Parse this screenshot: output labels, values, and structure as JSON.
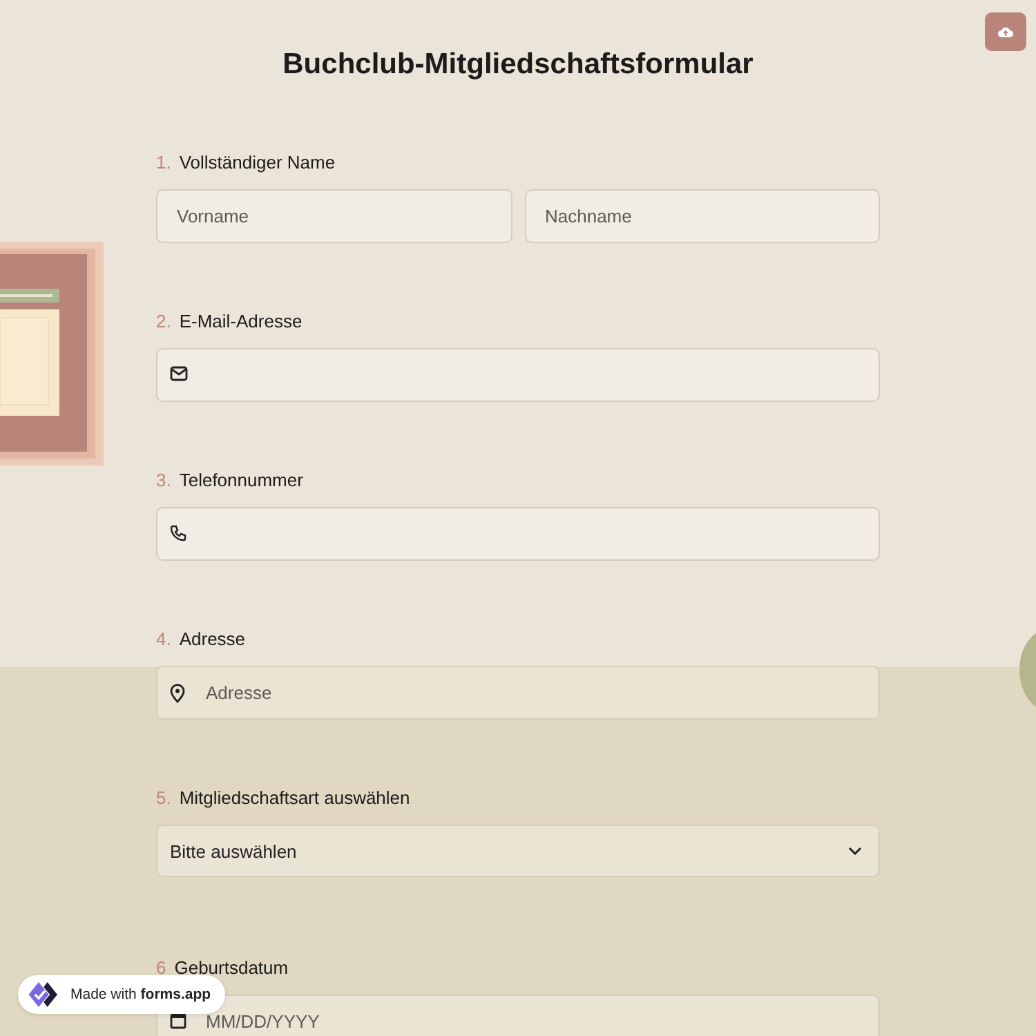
{
  "title": "Buchclub-Mitgliedschaftsformular",
  "questions": [
    {
      "number": "1.",
      "label": "Vollständiger Name",
      "kind": "name",
      "fields": [
        {
          "placeholder": "Vorname"
        },
        {
          "placeholder": "Nachname"
        }
      ]
    },
    {
      "number": "2.",
      "label": "E-Mail-Adresse",
      "kind": "email"
    },
    {
      "number": "3.",
      "label": "Telefonnummer",
      "kind": "phone"
    },
    {
      "number": "4.",
      "label": "Adresse",
      "kind": "address",
      "placeholder": "Adresse"
    },
    {
      "number": "5.",
      "label": "Mitgliedschaftsart auswählen",
      "kind": "dropdown",
      "value": "Bitte auswählen"
    },
    {
      "number": "6",
      "label": "Geburtsdatum",
      "kind": "date",
      "placeholder": "MM/DD/YYYY"
    }
  ],
  "badge": "Made with **forms.app**"
}
